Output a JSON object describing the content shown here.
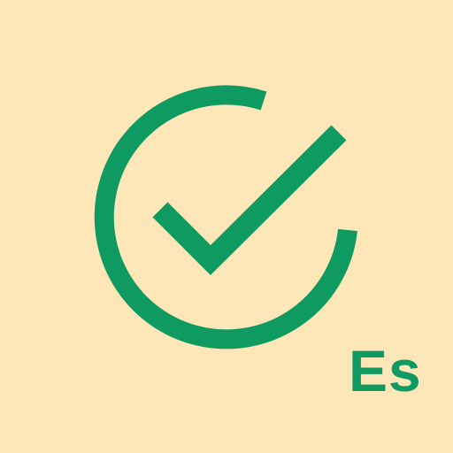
{
  "app_icon": {
    "logo": {
      "icon": "check-circle-icon",
      "color": "#0f9a61"
    },
    "badge": {
      "text": "Es",
      "color": "#0f9a61"
    },
    "background_color": "#fde6b7"
  }
}
